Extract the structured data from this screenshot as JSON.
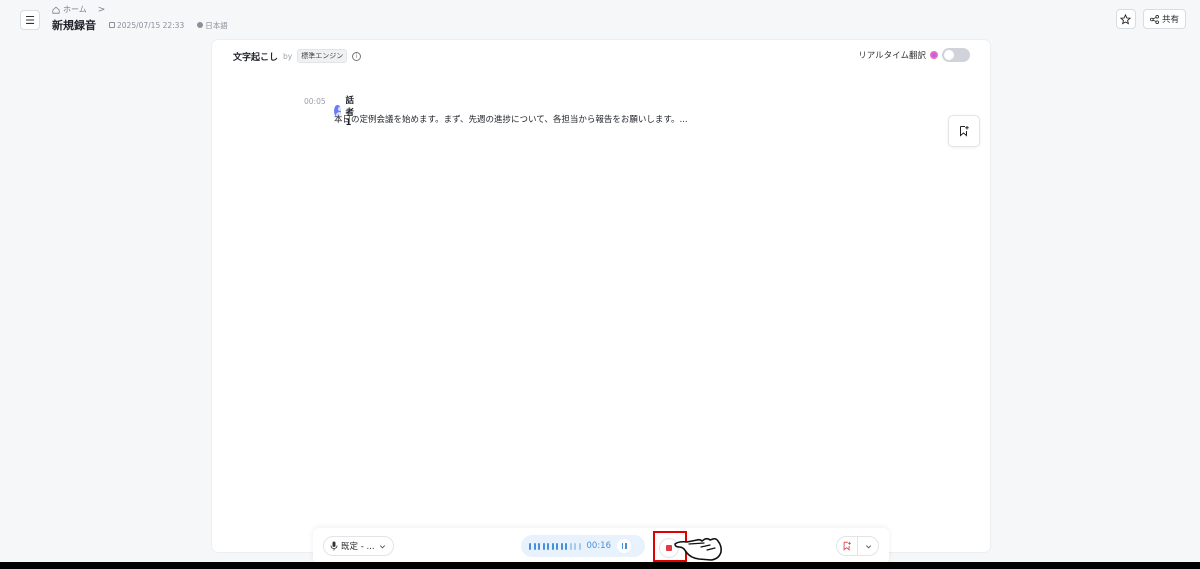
{
  "header": {
    "breadcrumb_home": "ホーム",
    "breadcrumb_sep": ">",
    "title": "新規録音",
    "datetime": "2025/07/15 22:33",
    "language": "日本語",
    "share_label": "共有"
  },
  "panel": {
    "title": "文字起こし",
    "by": "by",
    "engine": "標準エンジン",
    "info": "i",
    "realtime_translate_label": "リアルタイム翻訳",
    "realtime_translate_enabled": false,
    "entries": [
      {
        "time": "00:05",
        "speaker": "話者 1",
        "text": "本日の定例会議を始めます。まず、先週の進捗について、各担当から報告をお願いします。..."
      }
    ]
  },
  "controlbar": {
    "mic_label": "既定 - ...",
    "elapsed": "00:16",
    "level_bars_active": 9,
    "level_bars_total": 12
  },
  "icons": {
    "menu": "menu-icon",
    "home": "home-icon",
    "calendar": "calendar-icon",
    "globe": "globe-icon",
    "star": "star-icon",
    "share": "share-icon",
    "bookmark": "bookmark-plus-icon",
    "mic": "mic-icon",
    "pause": "pause-icon",
    "stop": "stop-icon",
    "chevron": "chevron-down-icon",
    "cursor": "hand-pointer-icon"
  },
  "colors": {
    "accent": "#4a90d9",
    "stop": "#e63946",
    "highlight": "#e00000",
    "bookmark": "#e5484d"
  }
}
